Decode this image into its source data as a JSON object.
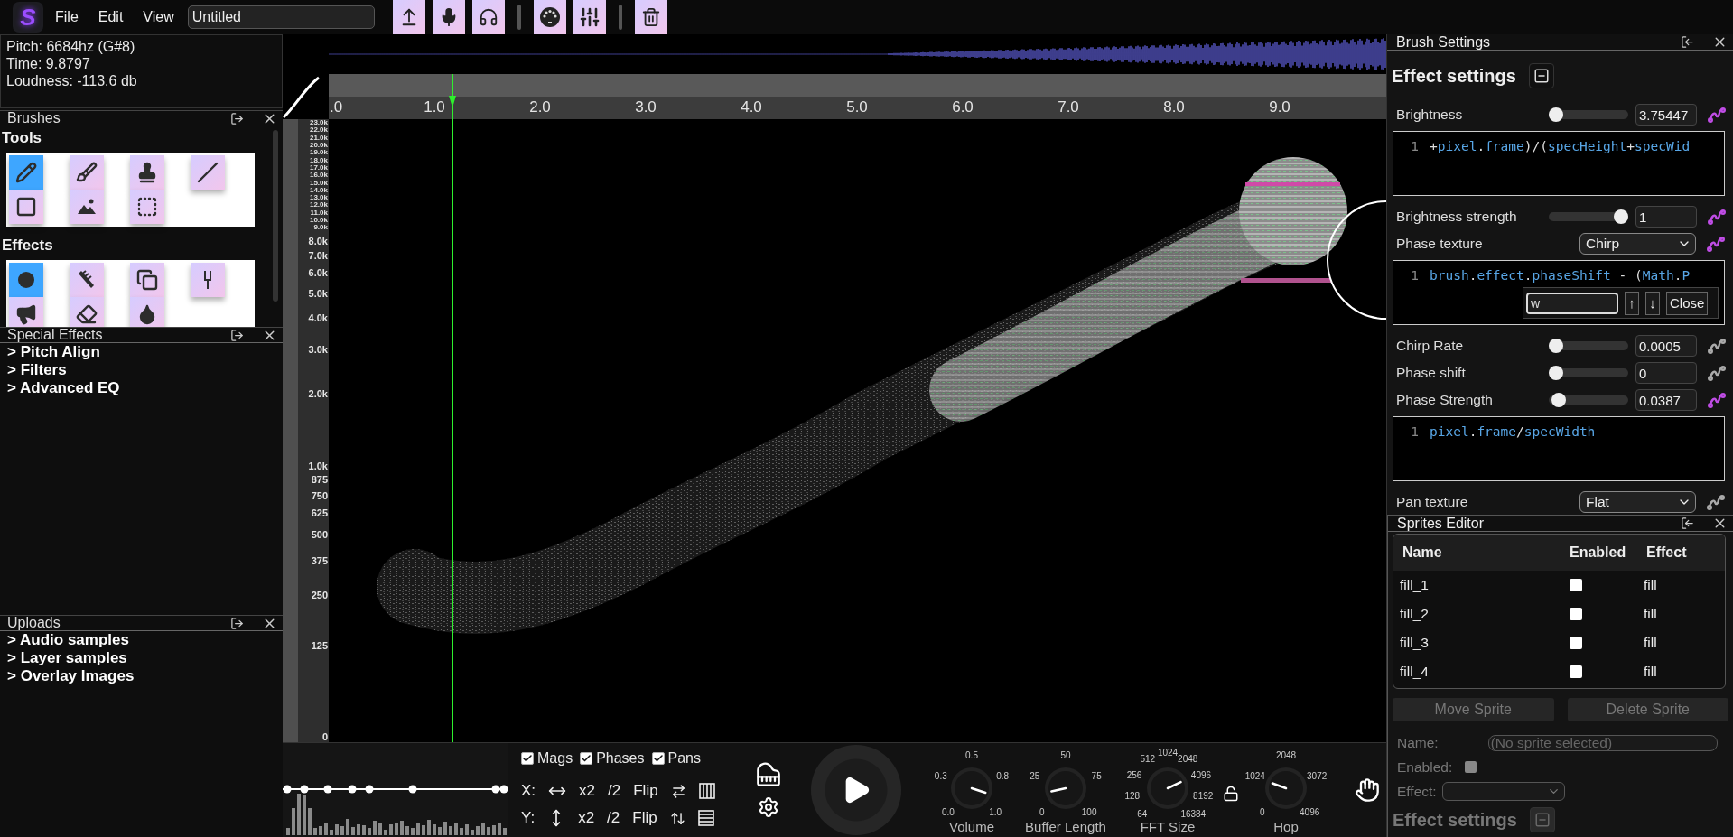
{
  "app": {
    "logo": "S",
    "menus": [
      "File",
      "Edit",
      "View"
    ],
    "title_field": {
      "value": "Untitled"
    }
  },
  "info": [
    "Pitch: 6684hz (G#8)",
    "Time: 9.8797",
    "Loudness: -113.6 db"
  ],
  "brushes_panel": {
    "title": "Brushes",
    "sections": [
      {
        "heading": "Tools",
        "items": [
          {
            "kind": "pencil",
            "selected": true
          },
          {
            "kind": "brush",
            "selected": false
          },
          {
            "kind": "stamp",
            "selected": false
          },
          {
            "kind": "line",
            "selected": false
          },
          {
            "kind": "rectangle",
            "selected": false
          },
          {
            "kind": "image",
            "selected": false
          },
          {
            "kind": "selection",
            "selected": false
          }
        ]
      },
      {
        "heading": "Effects",
        "items": [
          {
            "kind": "circle",
            "selected": true
          },
          {
            "kind": "comb",
            "selected": false
          },
          {
            "kind": "overlap",
            "selected": false
          },
          {
            "kind": "fork",
            "selected": false
          },
          {
            "kind": "megaphone",
            "selected": false
          },
          {
            "kind": "eraser",
            "selected": false
          },
          {
            "kind": "droplet",
            "selected": false
          }
        ]
      }
    ]
  },
  "special_effects_panel": {
    "title": "Special Effects",
    "items": [
      {
        "marker": ">",
        "label": "Pitch Align"
      },
      {
        "marker": ">",
        "label": "Filters"
      },
      {
        "marker": ">",
        "label": "Advanced EQ"
      }
    ]
  },
  "uploads_panel": {
    "title": "Uploads",
    "items": [
      {
        "marker": ">",
        "label": "Audio samples"
      },
      {
        "marker": ">",
        "label": "Layer samples"
      },
      {
        "marker": ">",
        "label": "Overlay Images"
      }
    ]
  },
  "time_ruler": {
    "ticks": [
      ".0",
      "1.0",
      "2.0",
      "3.0",
      "4.0",
      "5.0",
      "6.0",
      "7.0",
      "8.0",
      "9.0"
    ]
  },
  "frequency_axis": {
    "ticks": [
      "23.0k",
      "22.0k",
      "21.0k",
      "20.0k",
      "19.0k",
      "18.0k",
      "17.0k",
      "16.0k",
      "15.0k",
      "14.0k",
      "13.0k",
      "12.0k",
      "11.0k",
      "10.0k",
      "9.0k",
      "8.0k",
      "7.0k",
      "6.0k",
      "5.0k",
      "4.0k",
      "3.0k",
      "2.0k",
      "1.0k",
      "875",
      "750",
      "625",
      "500",
      "375",
      "250",
      "125",
      "0"
    ]
  },
  "bottom_bar": {
    "channels": [
      {
        "label": "Mags",
        "checked": true
      },
      {
        "label": "Phases",
        "checked": true
      },
      {
        "label": "Pans",
        "checked": true
      }
    ],
    "axes": [
      {
        "kind": "x",
        "label": "X:",
        "zoom_in": "x2",
        "zoom_out": "/2",
        "flip": "Flip"
      },
      {
        "kind": "y",
        "label": "Y:",
        "zoom_in": "x2",
        "zoom_out": "/2",
        "flip": "Flip"
      }
    ],
    "knobs": [
      {
        "label": "Volume",
        "level": 0.9,
        "ticks": [
          "0.0",
          "0.3",
          "0.5",
          "0.8",
          "1.0"
        ]
      },
      {
        "label": "Buffer Length",
        "level": 0.12,
        "ticks": [
          "0",
          "25",
          "50",
          "75",
          "100"
        ]
      },
      {
        "label": "FFT Size",
        "level": 0.74,
        "ticks": [
          "64",
          "128",
          "256",
          "512",
          "1024",
          "2048",
          "4096",
          "8192",
          "16384"
        ]
      },
      {
        "label": "Hop",
        "level": 0.24,
        "ticks": [
          "0",
          "1024",
          "2048",
          "3072",
          "4096"
        ]
      }
    ],
    "lock": {
      "locked": false
    }
  },
  "brush_settings": {
    "title": "Brush Settings",
    "section_title": "Effect settings",
    "rows": [
      {
        "kind": "slider",
        "label": "Brightness",
        "level": 0,
        "value": "3.75447",
        "linked": true
      },
      {
        "kind": "code",
        "line": "1",
        "code": "+pixel.frame)/(specHeight+specWid"
      },
      {
        "kind": "slider",
        "label": "Brightness strength",
        "level": 1,
        "value": "1",
        "linked": true
      },
      {
        "kind": "select",
        "label": "Phase texture",
        "value": "Chirp",
        "linked": true
      },
      {
        "kind": "code",
        "line": "1",
        "code": "brush.effect.phaseShift - (Math.P",
        "find": {
          "value": "w",
          "up": "↑",
          "down": "↓",
          "close": "Close"
        }
      },
      {
        "kind": "slider",
        "label": "Chirp Rate",
        "level": 0,
        "value": "0.0005",
        "linked": false
      },
      {
        "kind": "slider",
        "label": "Phase shift",
        "level": 0,
        "value": "0",
        "linked": false
      },
      {
        "kind": "slider",
        "label": "Phase Strength",
        "level": 0.04,
        "value": "0.0387",
        "linked": true
      },
      {
        "kind": "code",
        "line": "1",
        "code": "pixel.frame/specWidth"
      },
      {
        "kind": "select",
        "label": "Pan texture",
        "value": "Flat",
        "linked": false
      }
    ]
  },
  "sprites_editor": {
    "title": "Sprites Editor",
    "columns": [
      "Name",
      "Enabled",
      "Effect"
    ],
    "rows": [
      {
        "name": "fill_1",
        "enabled": false,
        "effect": "fill"
      },
      {
        "name": "fill_2",
        "enabled": false,
        "effect": "fill"
      },
      {
        "name": "fill_3",
        "enabled": false,
        "effect": "fill"
      },
      {
        "name": "fill_4",
        "enabled": false,
        "effect": "fill"
      }
    ],
    "buttons": [
      {
        "label": "Move Sprite",
        "disabled": true
      },
      {
        "label": "Delete Sprite",
        "disabled": true
      }
    ],
    "form": {
      "name_label": "Name:",
      "placeholder": "(No sprite selected)",
      "enabled_label": "Enabled:",
      "enabled_checked": false,
      "effect_label": "Effect:",
      "disabled": true
    },
    "section_title": "Effect settings"
  }
}
